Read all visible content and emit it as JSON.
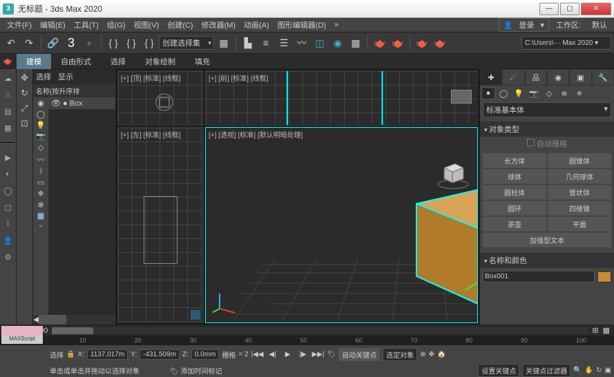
{
  "window": {
    "title": "无标题 - 3ds Max 2020"
  },
  "menubar": {
    "items": [
      "文件(F)",
      "编辑(E)",
      "工具(T)",
      "组(G)",
      "视图(V)",
      "创建(C)",
      "修改器(M)",
      "动画(A)",
      "图形编辑器(D)"
    ],
    "login": "登录",
    "workspace_label": "工作区:",
    "workspace": "默认"
  },
  "toolbar": {
    "selset": "创建选择集",
    "path": "C:\\Users\\··· Max 2020 ▾"
  },
  "ribbon": {
    "tabs": [
      "建模",
      "自由形式",
      "选择",
      "对象绘制",
      "填充"
    ]
  },
  "scene_explorer": {
    "tab_select": "选择",
    "tab_display": "显示",
    "name_header": "名称(按升序排",
    "item": "Box"
  },
  "viewports": {
    "top": "[+] [顶] [标准] [线框]",
    "front": "[+] [前] [标准] [线框]",
    "left": "[+] [左] [标准] [线框]",
    "persp": "[+] [透视] [标准] [默认明暗处理]"
  },
  "cmd": {
    "category": "标准基本体",
    "rollout_objtype": "对象类型",
    "autogrid": "自动栅格",
    "buttons": [
      "长方体",
      "圆锥体",
      "球体",
      "几何球体",
      "圆柱体",
      "管状体",
      "圆环",
      "四棱锥",
      "茶壶",
      "平面"
    ],
    "extruded": "加强型文本",
    "rollout_name": "名称和颜色",
    "obj_name": "Box001"
  },
  "timeline": {
    "frame": "0 / 100",
    "ticks": [
      "0",
      "10",
      "20",
      "30",
      "40",
      "50",
      "60",
      "70",
      "80",
      "90",
      "100"
    ]
  },
  "status": {
    "sel": "选择",
    "lock": "🔒",
    "x_lbl": "X:",
    "x": "1137.017m",
    "y_lbl": "Y:",
    "y": "-431.509m",
    "z_lbl": "Z:",
    "z": "0.0mm",
    "grid_lbl": "栅格",
    "grid_val": "= 2",
    "add_time": "添加时间标记",
    "autokey": "自动关键点",
    "selected": "选定对象",
    "setkey": "设置关键点",
    "keyfilter": "关键点过滤器",
    "hint": "单击或单击并拖动以选择对象"
  },
  "maxscript": "MAXScript"
}
